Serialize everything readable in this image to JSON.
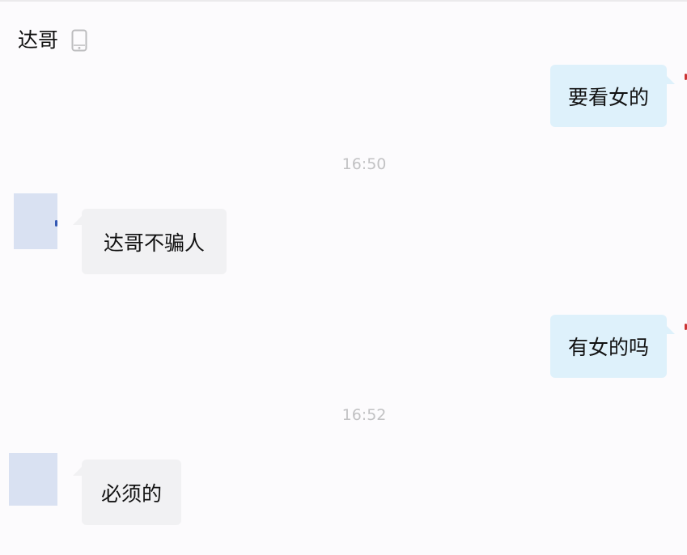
{
  "header": {
    "contact_name": "达哥",
    "device_icon": "mobile-phone-icon"
  },
  "messages": [
    {
      "direction": "outgoing",
      "text": "要看女的"
    },
    {
      "type": "timestamp",
      "text": "16:50"
    },
    {
      "direction": "incoming",
      "text": "达哥不骗人"
    },
    {
      "direction": "outgoing",
      "text": "有女的吗"
    },
    {
      "type": "timestamp",
      "text": "16:52"
    },
    {
      "direction": "incoming",
      "text": "必须的"
    }
  ],
  "colors": {
    "background": "#fcfbfd",
    "outgoing_bubble": "#def1fb",
    "incoming_bubble": "#f1f1f3",
    "timestamp_text": "#c2c2c4",
    "avatar_placeholder": "#d9e1f2"
  }
}
